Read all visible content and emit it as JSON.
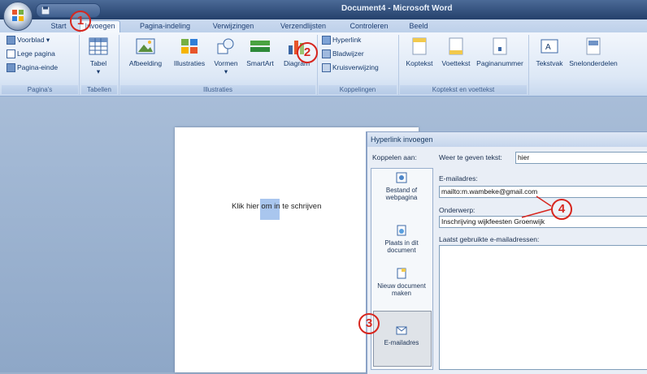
{
  "window": {
    "title": "Document4 - Microsoft Word"
  },
  "tabs": [
    {
      "label": "Start"
    },
    {
      "label": "Invoegen"
    },
    {
      "label": "Pagina-indeling"
    },
    {
      "label": "Verwijzingen"
    },
    {
      "label": "Verzendlijsten"
    },
    {
      "label": "Controleren"
    },
    {
      "label": "Beeld"
    }
  ],
  "ribbon": {
    "paginas": {
      "voorblad": "Voorblad",
      "lege_pagina": "Lege pagina",
      "pagina_einde": "Pagina-einde",
      "label": "Pagina's"
    },
    "tabellen": {
      "tabel": "Tabel",
      "label": "Tabellen"
    },
    "illustraties": {
      "afbeelding": "Afbeelding",
      "illustraties": "Illustraties",
      "vormen": "Vormen",
      "smartart": "SmartArt",
      "diagram": "Diagram",
      "label": "Illustraties"
    },
    "koppelingen": {
      "hyperlink": "Hyperlink",
      "bladwijzer": "Bladwijzer",
      "kruisverwijzing": "Kruisverwijzing",
      "label": "Koppelingen"
    },
    "kopvoet": {
      "koptekst": "Koptekst",
      "voettekst": "Voettekst",
      "paginanummer": "Paginanummer",
      "label": "Koptekst en voettekst"
    },
    "tekst": {
      "tekstvak": "Tekstvak",
      "snelonderdelen": "Snelonderdelen"
    }
  },
  "document": {
    "text_before": "Klik ",
    "highlighted": "hier",
    "text_after": " om in te schrijven"
  },
  "dialog": {
    "title": "Hyperlink invoegen",
    "koppelen_aan": "Koppelen aan:",
    "weer_te_geven_label": "Weer te geven tekst:",
    "weer_te_geven_value": "hier",
    "email_label": "E-mailadres:",
    "email_value": "mailto:m.wambeke@gmail.com",
    "onderwerp_label": "Onderwerp:",
    "onderwerp_value": "Inschrijving wijkfeesten Groenwijk",
    "recent_label": "Laatst gebruikte e-mailadressen:",
    "sidebar": {
      "bestand": "Bestand of webpagina",
      "plaats": "Plaats in dit document",
      "nieuw": "Nieuw document maken",
      "email": "E-mailadres"
    }
  },
  "callouts": [
    "1",
    "2",
    "3",
    "4"
  ],
  "colors": {
    "accent_red": "#d7261e",
    "ribbon_blue": "#dde8f6",
    "title_bar": "#24406b"
  }
}
